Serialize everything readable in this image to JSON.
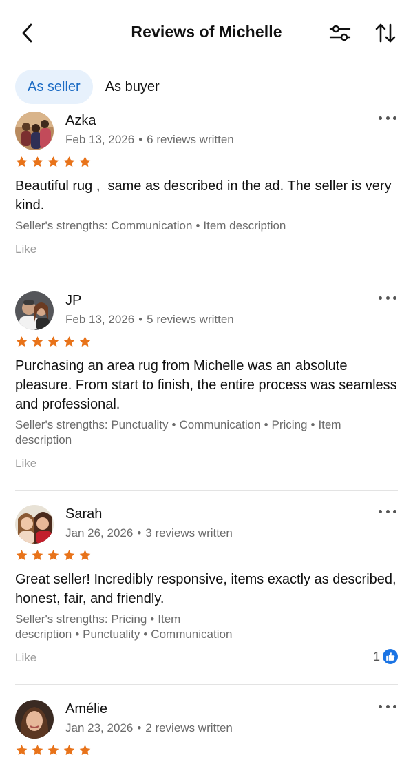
{
  "header": {
    "title": "Reviews of Michelle",
    "back_icon": "chevron-left-icon",
    "filter_icon": "sliders-icon",
    "sort_icon": "sort-arrows-icon"
  },
  "tabs": [
    {
      "label": "As seller",
      "active": true
    },
    {
      "label": "As buyer",
      "active": false
    }
  ],
  "colors": {
    "accent": "#1d6cc4",
    "tab_active_bg": "#e7f1fc",
    "star": "#e8731a",
    "like_badge": "#1b74e4"
  },
  "reviews": [
    {
      "name": "Azka",
      "date": "Feb 13, 2026",
      "reviews_written": "6 reviews written",
      "rating": 5,
      "text": "Beautiful rug ,  same as described in the ad. The seller is very kind.",
      "strengths_label": "Seller's strengths:",
      "strengths": [
        "Communication",
        "Item description"
      ],
      "like_label": "Like"
    },
    {
      "name": "JP",
      "date": "Feb 13, 2026",
      "reviews_written": "5 reviews written",
      "rating": 5,
      "text": "Purchasing an area rug from Michelle was an absolute pleasure. From start to finish, the entire process was seamless and professional.",
      "strengths_label": "Seller's strengths:",
      "strengths": [
        "Punctuality",
        "Communication",
        "Pricing",
        "Item description"
      ],
      "like_label": "Like"
    },
    {
      "name": "Sarah",
      "date": "Jan 26, 2026",
      "reviews_written": "3 reviews written",
      "rating": 5,
      "text": "Great seller! Incredibly responsive, items exactly as described, honest, fair, and friendly.",
      "strengths_label": "Seller's strengths:",
      "strengths": [
        "Pricing",
        "Item description",
        "Punctuality",
        "Communication"
      ],
      "like_label": "Like",
      "like_count": "1"
    },
    {
      "name": "Amélie",
      "date": "Jan 23, 2026",
      "reviews_written": "2 reviews written",
      "rating": 5
    }
  ]
}
